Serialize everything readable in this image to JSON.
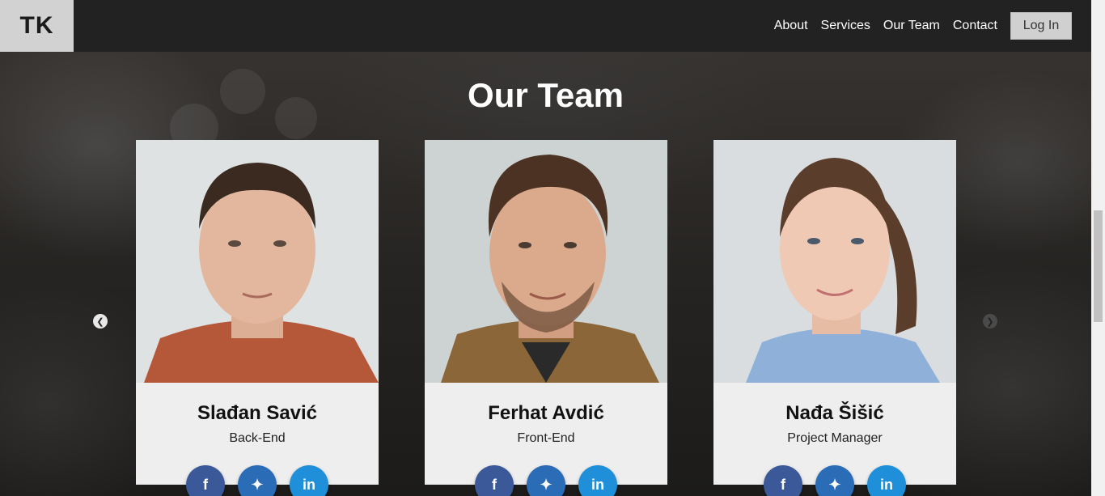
{
  "nav": {
    "logo": "TK",
    "links": [
      "About",
      "Services",
      "Our Team",
      "Contact"
    ],
    "login": "Log In"
  },
  "section": {
    "title": "Our Team"
  },
  "team": [
    {
      "name": "Slađan Savić",
      "role": "Back-End",
      "shirt": "#b5583a",
      "hair": "#3a2a20",
      "skin": "#e3b79d",
      "bg": "#dfe2e3"
    },
    {
      "name": "Ferhat Avdić",
      "role": "Front-End",
      "shirt": "#8a6638",
      "hair": "#4b3222",
      "skin": "#dba98c",
      "bg": "#cdd3d3"
    },
    {
      "name": "Nađa Šišić",
      "role": "Project Manager",
      "shirt": "#8fb0d8",
      "hair": "#5a3d2a",
      "skin": "#efc9b3",
      "bg": "#d9dddf"
    }
  ],
  "social": {
    "facebook": "f",
    "twitter": "🐦",
    "linkedin": "in"
  },
  "colors": {
    "navbar": "#222222",
    "logo_bg": "#d2d2d2",
    "card_bg": "#eeeeee",
    "facebook": "#3b5998",
    "twitter": "#2b6cb6",
    "linkedin": "#1e8fd8"
  }
}
